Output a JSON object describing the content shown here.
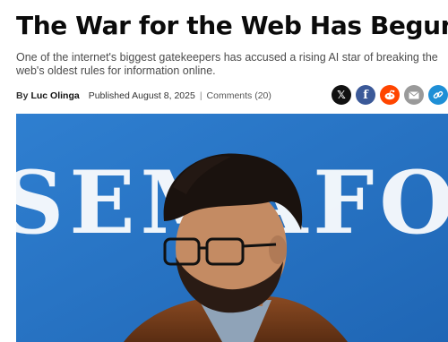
{
  "article": {
    "headline": "The War for the Web Has Begun",
    "subtitle": "One of the internet's biggest gatekeepers has accused a rising AI star of breaking the web's oldest rules for information online.",
    "byline_prefix": "By",
    "author": "Luc Olinga",
    "published": "Published August 8, 2025",
    "separator": "|",
    "comments": "Comments (20)"
  },
  "share": {
    "buttons": [
      {
        "name": "x",
        "glyph": "𝕏",
        "color": "#111111"
      },
      {
        "name": "facebook",
        "glyph": "f",
        "color": "#3b5998"
      },
      {
        "name": "reddit",
        "glyph": "●",
        "color": "#ff4500"
      },
      {
        "name": "email",
        "glyph": "✉",
        "color": "#9a9a9a"
      },
      {
        "name": "link",
        "glyph": "🔗",
        "color": "#1f8fd6"
      }
    ]
  },
  "hero_image": {
    "backdrop_text": "SEMAFO"
  }
}
